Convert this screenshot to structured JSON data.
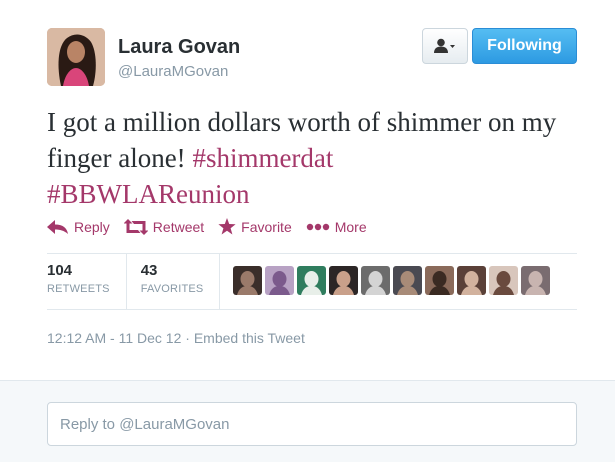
{
  "user": {
    "name": "Laura Govan",
    "handle": "@LauraMGovan"
  },
  "header": {
    "follow_label": "Following"
  },
  "tweet": {
    "text_part1": "I got a million dollars worth of shimmer on my finger alone! ",
    "hashtag1": "#shimmerdat",
    "hashtag2": "#BBWLAReunion"
  },
  "actions": {
    "reply": "Reply",
    "retweet": "Retweet",
    "favorite": "Favorite",
    "more": "More"
  },
  "stats": {
    "retweets_count": "104",
    "retweets_label": "RETWEETS",
    "favorites_count": "43",
    "favorites_label": "FAVORITES"
  },
  "meta": {
    "timestamp": "12:12 AM - 11 Dec 12",
    "separator": " · ",
    "embed": "Embed this Tweet"
  },
  "reply_box": {
    "placeholder": "Reply to @LauraMGovan"
  },
  "colors": {
    "link": "#a4386a",
    "follow_button": "#2d9ae2",
    "muted": "#8899a6"
  },
  "faces": [
    {
      "bg": "#3a2e2a",
      "fg": "#9a7a6a"
    },
    {
      "bg": "#b8a2c4",
      "fg": "#7b5a8c"
    },
    {
      "bg": "#2f7d5e",
      "fg": "#e8efe9"
    },
    {
      "bg": "#2c2626",
      "fg": "#c9a08a"
    },
    {
      "bg": "#6c6c6c",
      "fg": "#d4d4d4"
    },
    {
      "bg": "#4a4a52",
      "fg": "#a88b78"
    },
    {
      "bg": "#8a6a5a",
      "fg": "#3a2a22"
    },
    {
      "bg": "#5a4038",
      "fg": "#d2b29e"
    },
    {
      "bg": "#d8c6bc",
      "fg": "#6a4a3e"
    },
    {
      "bg": "#7a6c70",
      "fg": "#c8b4b0"
    }
  ]
}
